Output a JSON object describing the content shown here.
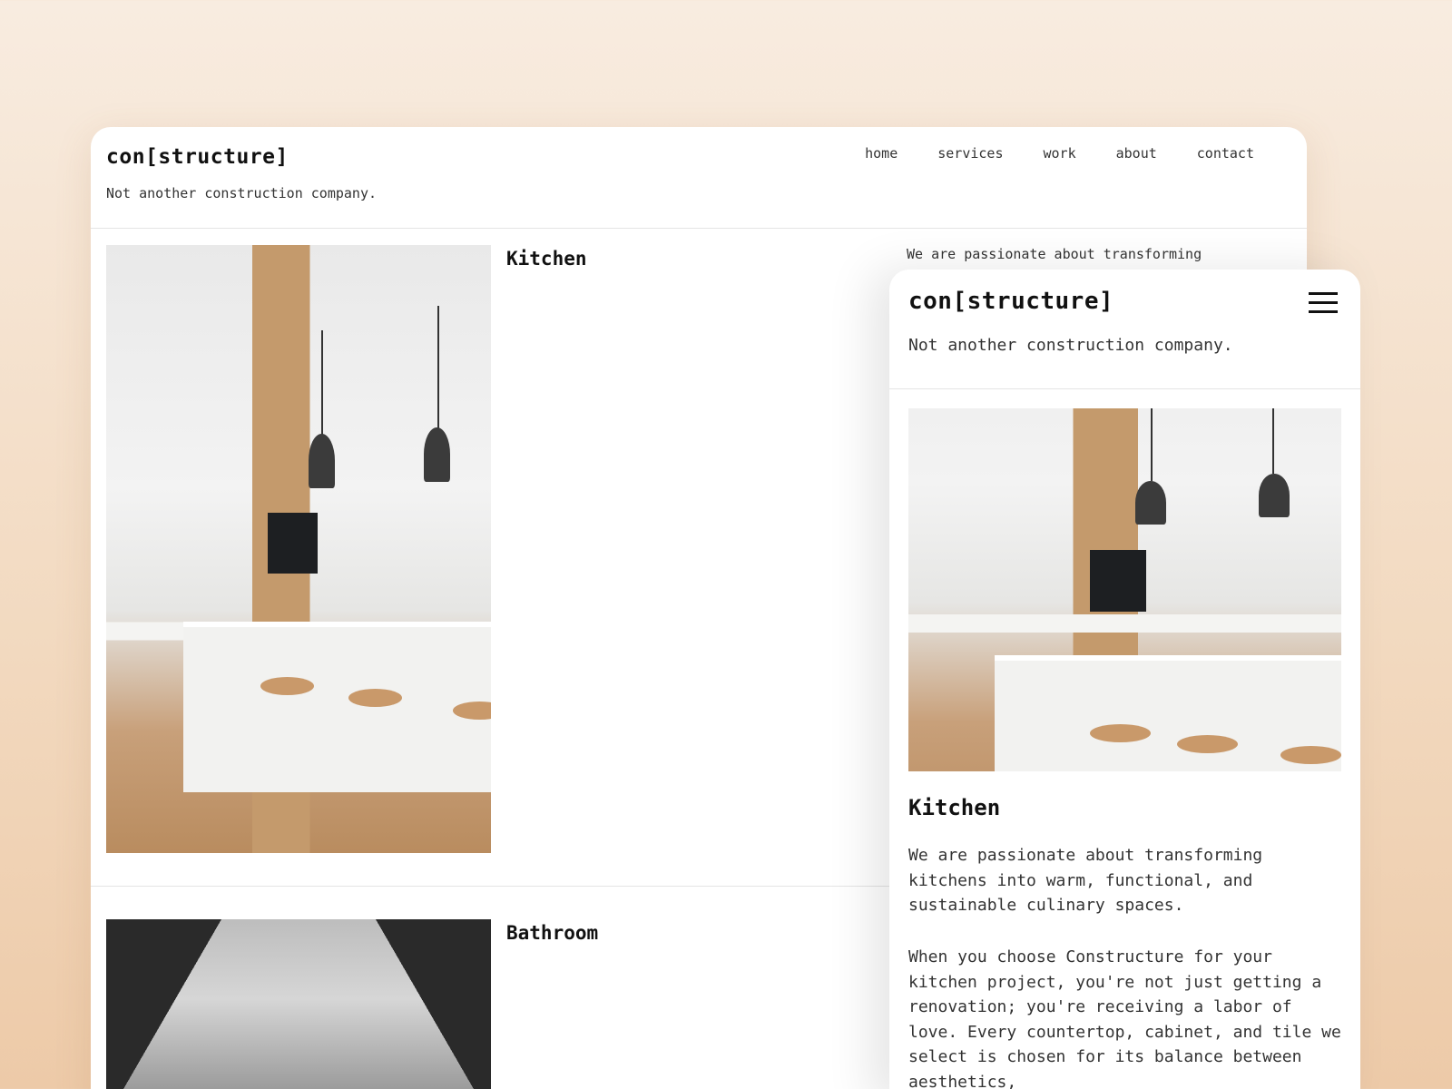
{
  "desktop": {
    "logo": "con[structure]",
    "tagline": "Not another construction company.",
    "nav": [
      "home",
      "services",
      "work",
      "about",
      "contact"
    ],
    "sections": [
      {
        "title": "Kitchen",
        "text": "We are passionate about transforming"
      },
      {
        "title": "Bathroom"
      }
    ]
  },
  "mobile": {
    "logo": "con[structure]",
    "tagline": "Not another construction company.",
    "menu_icon": "hamburger-icon",
    "section_title": "Kitchen",
    "paragraphs": [
      "We are passionate about transforming kitchens into warm, functional, and sustainable culinary spaces.",
      "When you choose Constructure for your kitchen project, you're not just getting a renovation; you're receiving a labor of love. Every countertop, cabinet, and tile we select is chosen for its balance between aesthetics,"
    ]
  }
}
